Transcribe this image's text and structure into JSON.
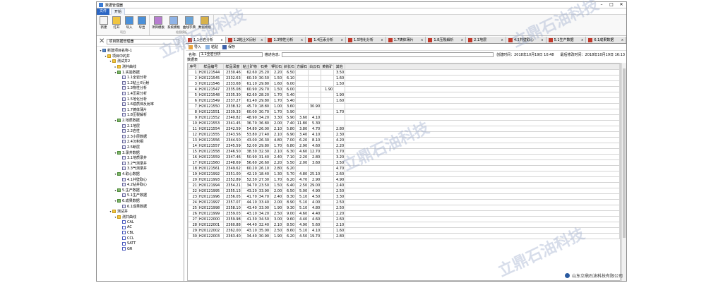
{
  "window": {
    "title": "数据管理器"
  },
  "menu": {
    "file": "文件",
    "tab": "开始"
  },
  "ribbon": {
    "groups": [
      {
        "label": "项目",
        "buttons": [
          {
            "label": "新建",
            "icon": "new-icon"
          },
          {
            "label": "打开",
            "icon": "open-icon"
          },
          {
            "label": "导入",
            "icon": "import-icon"
          },
          {
            "label": "导出",
            "icon": "export-icon"
          }
        ]
      },
      {
        "label": "绘图模板",
        "buttons": [
          {
            "label": "项目模板",
            "icon": "project-template-icon"
          },
          {
            "label": "系统模板",
            "icon": "system-template-icon"
          },
          {
            "label": "曲线字典",
            "icon": "curve-dict-icon"
          },
          {
            "label": "数据模板",
            "icon": "data-template-icon"
          }
        ]
      }
    ]
  },
  "left_panel": {
    "title": "项目数据管理器",
    "tree": [
      {
        "label": "新建项目名称-1",
        "level": 0,
        "icon": "db",
        "toggle": "▾"
      },
      {
        "label": "项目中的井",
        "level": 1,
        "icon": "fold",
        "toggle": "▾"
      },
      {
        "label": "测试井2",
        "level": 2,
        "icon": "fold",
        "toggle": "▾"
      },
      {
        "label": "测井曲线",
        "level": 3,
        "icon": "fold",
        "toggle": "▸"
      },
      {
        "label": "1.实验数据",
        "level": 3,
        "icon": "chart",
        "toggle": "▾"
      },
      {
        "label": "1.1全岩分析",
        "level": 4,
        "icon": "doc",
        "toggle": ""
      },
      {
        "label": "1.2粘土X衍射",
        "level": 4,
        "icon": "doc",
        "toggle": ""
      },
      {
        "label": "1.3物性分析",
        "level": 4,
        "icon": "doc",
        "toggle": ""
      },
      {
        "label": "1.4压汞分析",
        "level": 4,
        "icon": "doc",
        "toggle": ""
      },
      {
        "label": "1.5地化分析",
        "level": 4,
        "icon": "doc",
        "toggle": ""
      },
      {
        "label": "1.6镜质体反射率",
        "level": 4,
        "icon": "doc",
        "toggle": ""
      },
      {
        "label": "1.7铸体薄片",
        "level": 4,
        "icon": "doc",
        "toggle": ""
      },
      {
        "label": "1.8压裂解析",
        "level": 4,
        "icon": "doc",
        "toggle": ""
      },
      {
        "label": "2.地质数据",
        "level": 3,
        "icon": "chart",
        "toggle": "▾"
      },
      {
        "label": "2.1地层",
        "level": 4,
        "icon": "doc",
        "toggle": ""
      },
      {
        "label": "2.2岩性",
        "level": 4,
        "icon": "doc",
        "toggle": ""
      },
      {
        "label": "2.3小层数据",
        "level": 4,
        "icon": "doc",
        "toggle": ""
      },
      {
        "label": "2.4沉积相",
        "level": 4,
        "icon": "doc",
        "toggle": ""
      },
      {
        "label": "2.5断层",
        "level": 4,
        "icon": "doc",
        "toggle": ""
      },
      {
        "label": "3.录井数据",
        "level": 3,
        "icon": "chart",
        "toggle": "▾"
      },
      {
        "label": "3.1地质录井",
        "level": 4,
        "icon": "doc",
        "toggle": ""
      },
      {
        "label": "3.2气测录井",
        "level": 4,
        "icon": "doc",
        "toggle": ""
      },
      {
        "label": "3.3气测录井",
        "level": 4,
        "icon": "doc",
        "toggle": ""
      },
      {
        "label": "4.取心数据",
        "level": 3,
        "icon": "chart",
        "toggle": "▾"
      },
      {
        "label": "4.1井壁取心",
        "level": 4,
        "icon": "doc",
        "toggle": ""
      },
      {
        "label": "4.2钻井取心",
        "level": 4,
        "icon": "doc",
        "toggle": ""
      },
      {
        "label": "5.生产数据",
        "level": 3,
        "icon": "chart",
        "toggle": "▾"
      },
      {
        "label": "5.1生产数据",
        "level": 4,
        "icon": "doc",
        "toggle": ""
      },
      {
        "label": "6.成果数据",
        "level": 3,
        "icon": "chart",
        "toggle": "▾"
      },
      {
        "label": "6.1成果数据",
        "level": 4,
        "icon": "doc",
        "toggle": ""
      },
      {
        "label": "测试井",
        "level": 2,
        "icon": "fold",
        "toggle": "▾"
      },
      {
        "label": "测井曲线",
        "level": 3,
        "icon": "fold",
        "toggle": "▾"
      },
      {
        "label": "CAL",
        "level": 4,
        "icon": "curve",
        "toggle": ""
      },
      {
        "label": "AC",
        "level": 4,
        "icon": "curve",
        "toggle": ""
      },
      {
        "label": "CBL",
        "level": 4,
        "icon": "curve",
        "toggle": ""
      },
      {
        "label": "CCL",
        "level": 4,
        "icon": "curve",
        "toggle": ""
      },
      {
        "label": "SATT",
        "level": 4,
        "icon": "curve",
        "toggle": ""
      },
      {
        "label": "GR",
        "level": 4,
        "icon": "curve",
        "toggle": ""
      }
    ]
  },
  "tabs": [
    {
      "label": "1.1全岩分析",
      "active": true
    },
    {
      "label": "1.2粘土X衍射",
      "active": false
    },
    {
      "label": "1.3物性分析",
      "active": false
    },
    {
      "label": "1.4压汞分析",
      "active": false
    },
    {
      "label": "1.5地化分析",
      "active": false
    },
    {
      "label": "1.7铸体薄片",
      "active": false
    },
    {
      "label": "1.8压裂解析",
      "active": false
    },
    {
      "label": "2.1地层",
      "active": false
    },
    {
      "label": "4.1井壁取心",
      "active": false
    },
    {
      "label": "5.1生产数据",
      "active": false
    },
    {
      "label": "6.1成果数据",
      "active": false
    }
  ],
  "toolbar2": {
    "import": "导入",
    "paste": "粘贴",
    "save": "保存"
  },
  "namebar": {
    "name_label": "名称:",
    "name_value": "1.1全岩分析",
    "desc_label": "描述信息:",
    "desc_value": "",
    "created": "创建时间：2018年10月19日 10:48",
    "modified": "最后修改时间：2018年10月19日 16:13"
  },
  "section_label": "数据表",
  "table": {
    "columns": [
      "序号",
      "样品编号",
      "样品深度",
      "粘土矿物",
      "石英",
      "钾长石",
      "斜长石",
      "方解石",
      "白云石",
      "黄铁矿",
      "其他"
    ],
    "rows": [
      [
        "1",
        "H20121544",
        "2330.46",
        "62.60",
        "25.20",
        "2.20",
        "6.50",
        "",
        "",
        "",
        "3.50"
      ],
      [
        "2",
        "H20121545",
        "2332.63",
        "60.30",
        "30.50",
        "1.50",
        "6.10",
        "",
        "",
        "",
        "1.60"
      ],
      [
        "3",
        "H20121546",
        "2333.68",
        "61.10",
        "29.80",
        "1.60",
        "6.00",
        "",
        "",
        "",
        "1.50"
      ],
      [
        "4",
        "H20121547",
        "2335.08",
        "60.90",
        "29.70",
        "1.50",
        "6.00",
        "",
        "",
        "1.90",
        ""
      ],
      [
        "5",
        "H20121548",
        "2335.30",
        "62.60",
        "28.20",
        "1.70",
        "5.40",
        "",
        "",
        "",
        "1.90"
      ],
      [
        "6",
        "H20121549",
        "2337.27",
        "61.40",
        "29.80",
        "1.70",
        "5.40",
        "",
        "",
        "",
        "1.60"
      ],
      [
        "7",
        "H20121550",
        "2338.32",
        "45.70",
        "18.80",
        "1.00",
        "3.60",
        "",
        "30.90",
        "",
        ""
      ],
      [
        "8",
        "H20121551",
        "2339.33",
        "60.00",
        "30.70",
        "1.70",
        "5.90",
        "",
        "",
        "",
        "1.70"
      ],
      [
        "9",
        "H20121552",
        "2340.82",
        "48.90",
        "34.20",
        "3.30",
        "5.90",
        "3.60",
        "4.10",
        "",
        ""
      ],
      [
        "10",
        "H20121553",
        "2341.45",
        "36.70",
        "36.80",
        "2.00",
        "7.40",
        "11.80",
        "5.30",
        "",
        ""
      ],
      [
        "11",
        "H20121554",
        "2342.59",
        "54.80",
        "26.00",
        "2.10",
        "5.80",
        "3.80",
        "4.70",
        "",
        "2.80"
      ],
      [
        "12",
        "H20121555",
        "2343.56",
        "53.80",
        "27.40",
        "2.10",
        "6.90",
        "3.40",
        "4.10",
        "",
        "2.30"
      ],
      [
        "13",
        "H20121556",
        "2344.50",
        "43.00",
        "26.30",
        "4.80",
        "7.00",
        "6.20",
        "8.10",
        "",
        "4.20"
      ],
      [
        "14",
        "H20121557",
        "2345.59",
        "52.00",
        "29.80",
        "1.70",
        "6.80",
        "2.90",
        "4.60",
        "",
        "2.20"
      ],
      [
        "15",
        "H20121558",
        "2346.50",
        "38.30",
        "32.30",
        "2.10",
        "6.30",
        "4.60",
        "12.70",
        "",
        "3.70"
      ],
      [
        "16",
        "H20121559",
        "2347.46",
        "50.90",
        "31.40",
        "2.40",
        "7.10",
        "2.20",
        "2.80",
        "",
        "3.20"
      ],
      [
        "17",
        "H20121560",
        "2348.69",
        "56.60",
        "26.60",
        "2.20",
        "5.50",
        "2.00",
        "3.60",
        "",
        "3.50"
      ],
      [
        "18",
        "H20121561",
        "2349.62",
        "60.20",
        "26.10",
        "2.80",
        "6.20",
        "",
        "",
        "",
        "4.70"
      ],
      [
        "19",
        "H20121992",
        "2351.00",
        "42.10",
        "18.40",
        "1.30",
        "5.70",
        "4.80",
        "25.10",
        "",
        "2.60"
      ],
      [
        "20",
        "H20121993",
        "2352.89",
        "52.30",
        "27.30",
        "1.70",
        "6.20",
        "4.70",
        "2.90",
        "",
        "4.90"
      ],
      [
        "21",
        "H20121994",
        "2354.21",
        "34.70",
        "23.50",
        "1.50",
        "6.40",
        "2.50",
        "29.00",
        "",
        "2.40"
      ],
      [
        "22",
        "H20121995",
        "2355.13",
        "43.20",
        "33.90",
        "2.00",
        "6.50",
        "5.00",
        "4.90",
        "",
        "2.50"
      ],
      [
        "23",
        "H20121996",
        "2356.05",
        "41.70",
        "34.70",
        "2.40",
        "8.30",
        "5.10",
        "4.50",
        "",
        "3.30"
      ],
      [
        "24",
        "H20121997",
        "2357.07",
        "44.10",
        "33.40",
        "2.00",
        "8.90",
        "5.10",
        "4.00",
        "",
        "2.50"
      ],
      [
        "25",
        "H20121998",
        "2358.10",
        "43.40",
        "33.00",
        "1.90",
        "9.30",
        "5.10",
        "4.80",
        "",
        "2.50"
      ],
      [
        "26",
        "H20121999",
        "2359.03",
        "43.10",
        "34.20",
        "2.50",
        "9.00",
        "4.60",
        "4.40",
        "",
        "2.20"
      ],
      [
        "27",
        "H20122000",
        "2359.98",
        "41.30",
        "34.50",
        "3.00",
        "9.60",
        "4.40",
        "4.60",
        "",
        "2.60"
      ],
      [
        "28",
        "H20122001",
        "2360.88",
        "44.40",
        "32.40",
        "2.10",
        "8.50",
        "4.90",
        "5.60",
        "",
        "2.10"
      ],
      [
        "29",
        "H20122002",
        "2362.00",
        "43.10",
        "35.00",
        "2.50",
        "8.60",
        "5.10",
        "4.10",
        "",
        "1.60"
      ],
      [
        "30",
        "H20122003",
        "2363.40",
        "34.40",
        "30.90",
        "1.90",
        "6.20",
        "4.50",
        "19.70",
        "",
        "2.80"
      ]
    ]
  },
  "watermark": "立鼎石油科技",
  "footer": {
    "company": "山东立鼎石油科技有限公司"
  }
}
